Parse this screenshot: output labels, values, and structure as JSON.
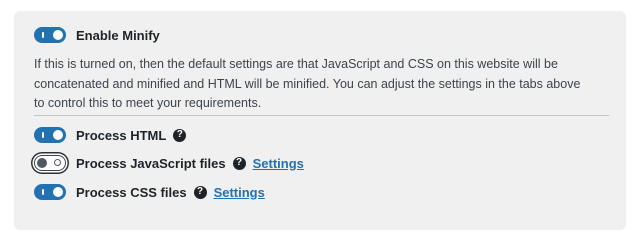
{
  "minify": {
    "label": "Enable Minify",
    "enabled": true,
    "description": "If this is turned on, then the default settings are that JavaScript and CSS on this website will be concatenated and minified and HTML will be minified. You can adjust the settings in the tabs above to control this to meet your requirements."
  },
  "options": [
    {
      "label": "Process HTML",
      "enabled": true,
      "help_icon": "question-circle-icon",
      "link": ""
    },
    {
      "label": "Process JavaScript files",
      "enabled": false,
      "help_icon": "question-circle-icon",
      "link": "Settings"
    },
    {
      "label": "Process CSS files",
      "enabled": true,
      "help_icon": "question-circle-icon",
      "link": "Settings"
    }
  ],
  "colors": {
    "accent": "#2271b1",
    "panel_bg": "#f0f0f1",
    "text": "#1d2327"
  }
}
